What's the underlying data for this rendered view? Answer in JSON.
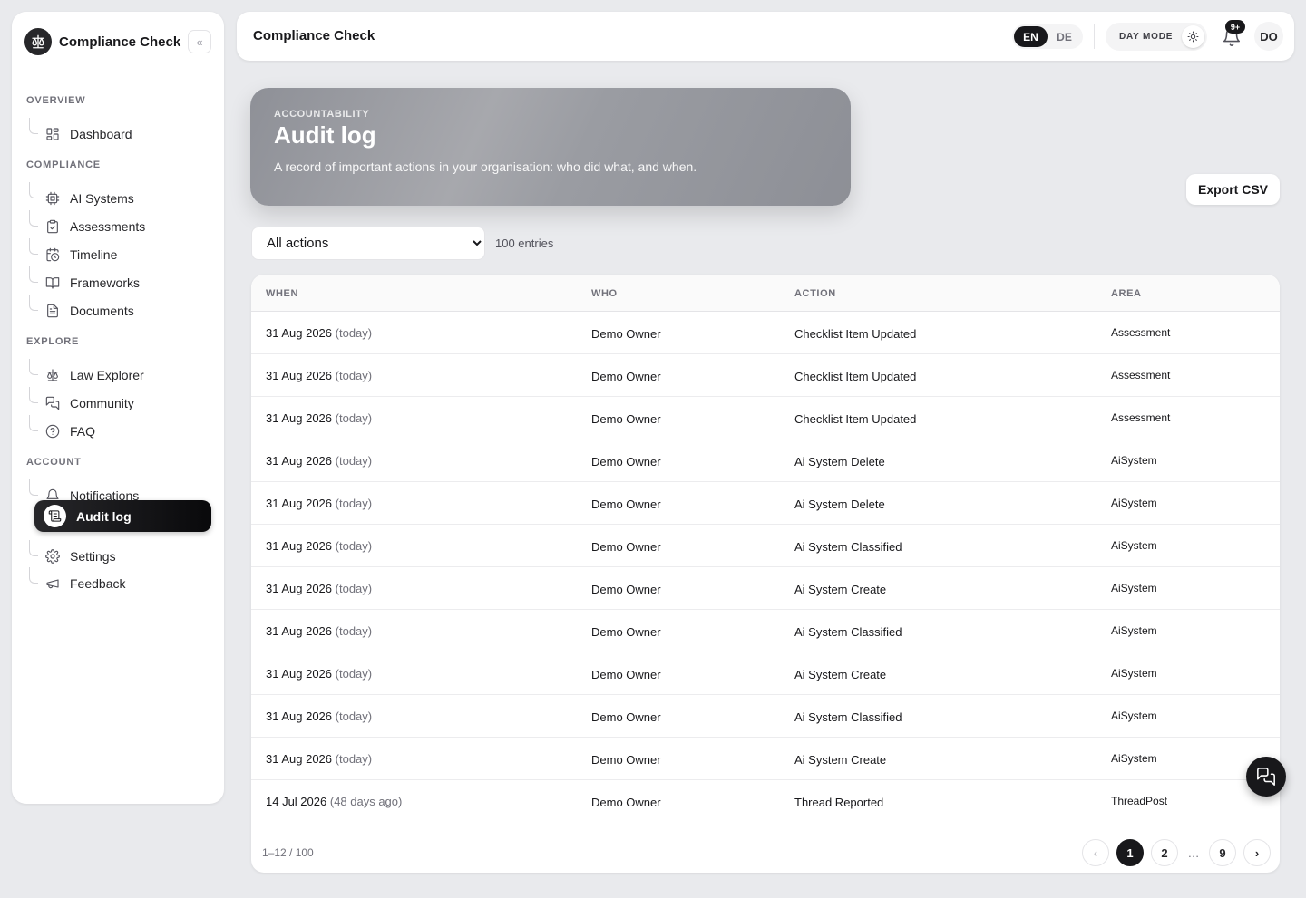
{
  "brand": {
    "name": "Compliance Check"
  },
  "sidebar": {
    "collapse_glyph": "«",
    "sections": [
      {
        "title": "OVERVIEW",
        "items": [
          {
            "label": "Dashboard",
            "icon": "dashboard-icon"
          }
        ]
      },
      {
        "title": "COMPLIANCE",
        "items": [
          {
            "label": "AI Systems",
            "icon": "chip-icon"
          },
          {
            "label": "Assessments",
            "icon": "clipboard-check-icon"
          },
          {
            "label": "Timeline",
            "icon": "calendar-clock-icon"
          },
          {
            "label": "Frameworks",
            "icon": "book-open-icon"
          },
          {
            "label": "Documents",
            "icon": "file-text-icon"
          }
        ]
      },
      {
        "title": "EXPLORE",
        "items": [
          {
            "label": "Law Explorer",
            "icon": "scale-icon"
          },
          {
            "label": "Community",
            "icon": "chat-bubbles-icon"
          },
          {
            "label": "FAQ",
            "icon": "help-circle-icon"
          }
        ]
      },
      {
        "title": "ACCOUNT",
        "items": [
          {
            "label": "Notifications",
            "icon": "bell-icon"
          },
          {
            "label": "Audit log",
            "icon": "scroll-icon",
            "active": true
          },
          {
            "label": "Settings",
            "icon": "gear-icon"
          },
          {
            "label": "Feedback",
            "icon": "megaphone-icon"
          }
        ]
      }
    ]
  },
  "topbar": {
    "title": "Compliance Check",
    "languages": [
      "EN",
      "DE"
    ],
    "active_language": "EN",
    "day_mode_label": "DAY MODE",
    "notification_badge": "9+",
    "avatar_initials": "DO"
  },
  "hero": {
    "eyebrow": "ACCOUNTABILITY",
    "title": "Audit log",
    "subtitle": "A record of important actions in your organisation: who did what, and when."
  },
  "actions": {
    "export_label": "Export CSV"
  },
  "filter": {
    "selected": "All actions",
    "options": [
      "All actions"
    ],
    "entries_label": "100 entries"
  },
  "table": {
    "columns": [
      "WHEN",
      "WHO",
      "ACTION",
      "AREA"
    ],
    "rows": [
      {
        "date": "31 Aug 2026",
        "rel": "(today)",
        "who": "Demo Owner",
        "action": "Checklist Item Updated",
        "area": "Assessment"
      },
      {
        "date": "31 Aug 2026",
        "rel": "(today)",
        "who": "Demo Owner",
        "action": "Checklist Item Updated",
        "area": "Assessment"
      },
      {
        "date": "31 Aug 2026",
        "rel": "(today)",
        "who": "Demo Owner",
        "action": "Checklist Item Updated",
        "area": "Assessment"
      },
      {
        "date": "31 Aug 2026",
        "rel": "(today)",
        "who": "Demo Owner",
        "action": "Ai System Delete",
        "area": "AiSystem"
      },
      {
        "date": "31 Aug 2026",
        "rel": "(today)",
        "who": "Demo Owner",
        "action": "Ai System Delete",
        "area": "AiSystem"
      },
      {
        "date": "31 Aug 2026",
        "rel": "(today)",
        "who": "Demo Owner",
        "action": "Ai System Classified",
        "area": "AiSystem"
      },
      {
        "date": "31 Aug 2026",
        "rel": "(today)",
        "who": "Demo Owner",
        "action": "Ai System Create",
        "area": "AiSystem"
      },
      {
        "date": "31 Aug 2026",
        "rel": "(today)",
        "who": "Demo Owner",
        "action": "Ai System Classified",
        "area": "AiSystem"
      },
      {
        "date": "31 Aug 2026",
        "rel": "(today)",
        "who": "Demo Owner",
        "action": "Ai System Create",
        "area": "AiSystem"
      },
      {
        "date": "31 Aug 2026",
        "rel": "(today)",
        "who": "Demo Owner",
        "action": "Ai System Classified",
        "area": "AiSystem"
      },
      {
        "date": "31 Aug 2026",
        "rel": "(today)",
        "who": "Demo Owner",
        "action": "Ai System Create",
        "area": "AiSystem"
      },
      {
        "date": "14 Jul 2026",
        "rel": "(48 days ago)",
        "who": "Demo Owner",
        "action": "Thread Reported",
        "area": "ThreadPost"
      }
    ]
  },
  "pagination": {
    "range_label": "1–12 / 100",
    "prev_glyph": "‹",
    "next_glyph": "›",
    "pages": [
      "1",
      "2",
      "…",
      "9"
    ],
    "current": "1"
  },
  "colors": {
    "accent": "#18181b",
    "background": "#e9eaed",
    "surface": "#ffffff"
  }
}
